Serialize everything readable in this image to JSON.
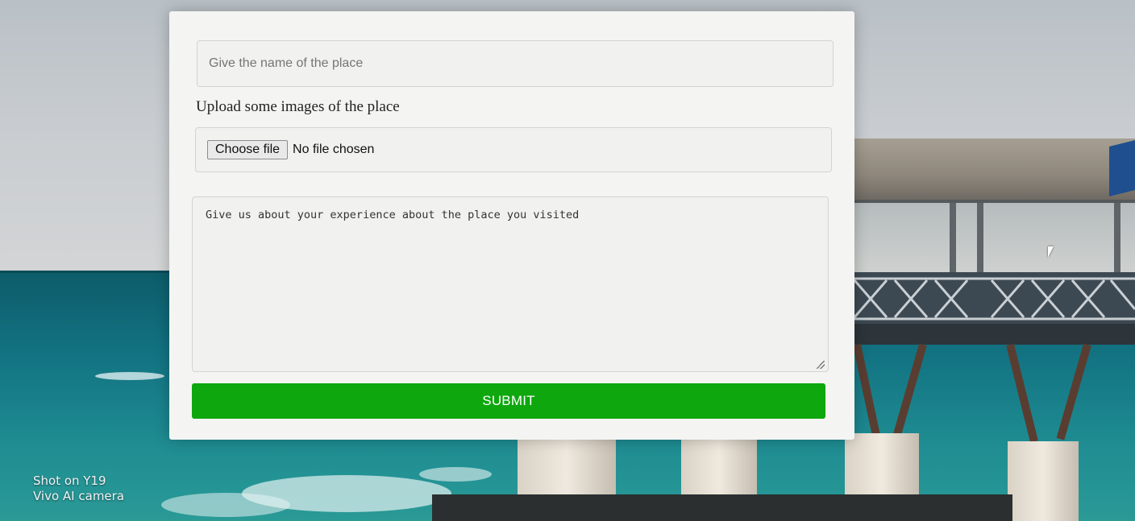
{
  "form": {
    "place_placeholder": "Give the name of the place",
    "place_value": "Give the name of the place",
    "upload_label": "Upload some images of the place",
    "choose_file_label": "Choose file",
    "no_file_text": "No file chosen",
    "experience_text": "Give us about your experience about the place you visited",
    "submit_label": "SUBMIT"
  },
  "watermark": {
    "line1": "Shot on Y19",
    "line2": "Vivo AI camera"
  },
  "colors": {
    "submit_bg": "#0ea70e",
    "card_bg": "#f4f4f3"
  }
}
